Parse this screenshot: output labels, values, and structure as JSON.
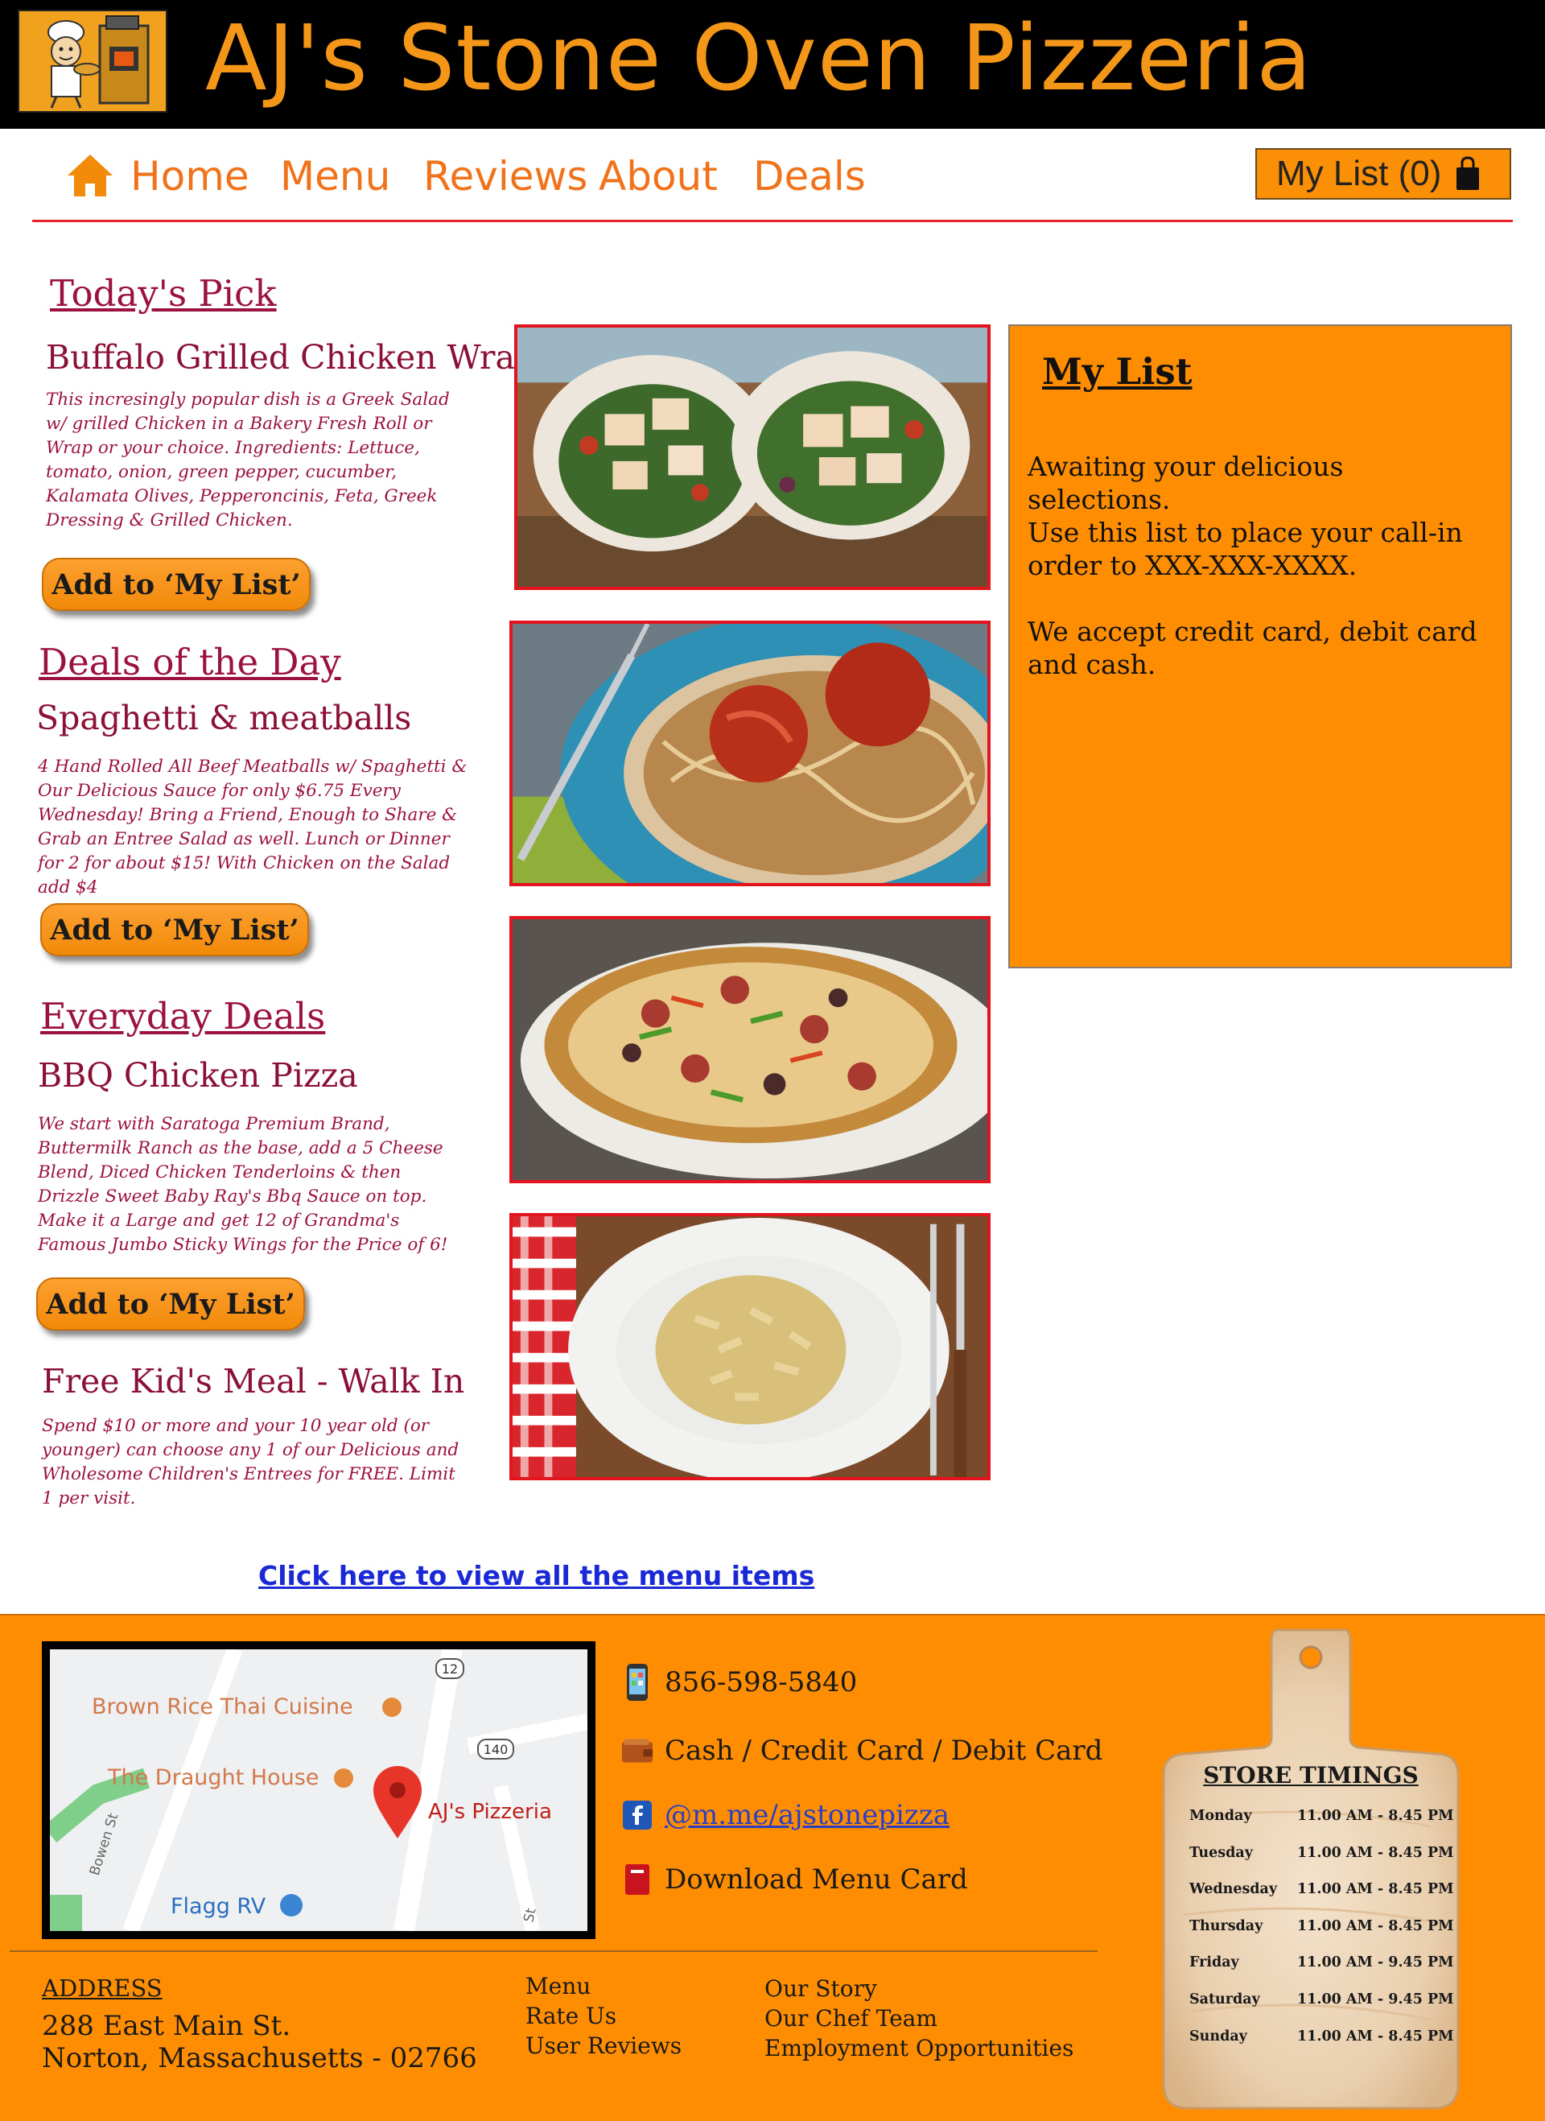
{
  "site": {
    "title": "AJ's Stone Oven Pizzeria"
  },
  "nav": {
    "items": [
      "Home",
      "Menu",
      "Reviews",
      "About",
      "Deals"
    ],
    "my_list_label": "My List (0)"
  },
  "todays_pick": {
    "heading": "Today's Pick",
    "title": "Buffalo Grilled Chicken Wrap",
    "description": "This incresingly popular dish is a Greek Salad w/ grilled Chicken in a Bakery Fresh Roll or Wrap or your choice. Ingredients: Lettuce, tomato, onion, green pepper, cucumber, Kalamata Olives, Pepperoncinis, Feta, Greek Dressing & Grilled Chicken.",
    "button": "Add to ‘My List’"
  },
  "deals_of_day": {
    "heading": "Deals of the Day",
    "title": "Spaghetti & meatballs",
    "description": "4 Hand Rolled All Beef Meatballs w/ Spaghetti & Our Delicious Sauce for only $6.75 Every Wednesday! Bring a Friend, Enough to Share & Grab an Entree Salad as well. Lunch or Dinner for 2 for about $15! With Chicken on the Salad add $4",
    "button": "Add to ‘My List’"
  },
  "everyday_deals": {
    "heading": "Everyday Deals",
    "title": "BBQ Chicken Pizza",
    "description": "We start with Saratoga Premium Brand, Buttermilk Ranch as the base, add a 5 Cheese Blend, Diced Chicken Tenderloins & then Drizzle Sweet Baby Ray's Bbq Sauce on top. Make it a Large and get 12 of Grandma's Famous Jumbo Sticky Wings for the Price of 6!",
    "button": "Add to ‘My List’"
  },
  "kids_meal": {
    "title": "Free Kid's Meal  - Walk In",
    "description": "Spend $10 or more and your 10 year old (or younger) can choose any 1 of our Delicious and Wholesome Children's Entrees for FREE. Limit 1 per visit."
  },
  "my_list": {
    "title": "My List",
    "paragraphs": [
      "Awaiting your delicious selections.",
      "Use this list to place your call-in order to XXX-XXX-XXXX.",
      "We accept credit card, debit card and cash."
    ]
  },
  "view_all_link": "Click here to view all the menu items",
  "map": {
    "labels": [
      "Brown Rice Thai Cuisine",
      "The Draught House",
      "AJ's Pizzeria",
      "Flagg RV",
      "Bowen St",
      "St"
    ],
    "route_labels": [
      "12",
      "140"
    ]
  },
  "contact": {
    "phone": "856-598-5840",
    "payment": "Cash / Credit Card / Debit Card",
    "facebook": "@m.me/ajstonepizza",
    "download": "Download Menu Card"
  },
  "address": {
    "heading": "ADDRESS",
    "line1": "288 East Main St.",
    "line2": "Norton, Massachusetts - 02766"
  },
  "footer_links": {
    "col1": [
      "Menu",
      "Rate Us",
      "User Reviews"
    ],
    "col2": [
      "Our Story",
      "Our Chef Team",
      "Employment Opportunities"
    ]
  },
  "store_timings": {
    "heading": "STORE TIMINGS",
    "rows": [
      {
        "day": "Monday",
        "hours": "11.00 AM - 8.45 PM"
      },
      {
        "day": "Tuesday",
        "hours": "11.00 AM - 8.45 PM"
      },
      {
        "day": "Wednesday",
        "hours": "11.00 AM - 8.45 PM"
      },
      {
        "day": "Thursday",
        "hours": "11.00 AM - 8.45 PM"
      },
      {
        "day": "Friday",
        "hours": "11.00 AM - 9.45 PM"
      },
      {
        "day": "Saturday",
        "hours": "11.00 AM - 9.45 PM"
      },
      {
        "day": "Sunday",
        "hours": "11.00 AM - 8.45 PM"
      }
    ]
  },
  "colors": {
    "brand_orange": "#ff8d01",
    "title_orange": "#f49719",
    "nav_orange": "#f0731c",
    "heading_crimson": "#9b1141",
    "accent_red": "#e3141d",
    "link_blue": "#1a29d6"
  },
  "icons": [
    "chef-oven-logo",
    "home-icon",
    "shopping-bag-icon",
    "phone-icon",
    "wallet-icon",
    "facebook-icon",
    "menu-card-icon",
    "map-pin-icon",
    "cutting-board"
  ]
}
